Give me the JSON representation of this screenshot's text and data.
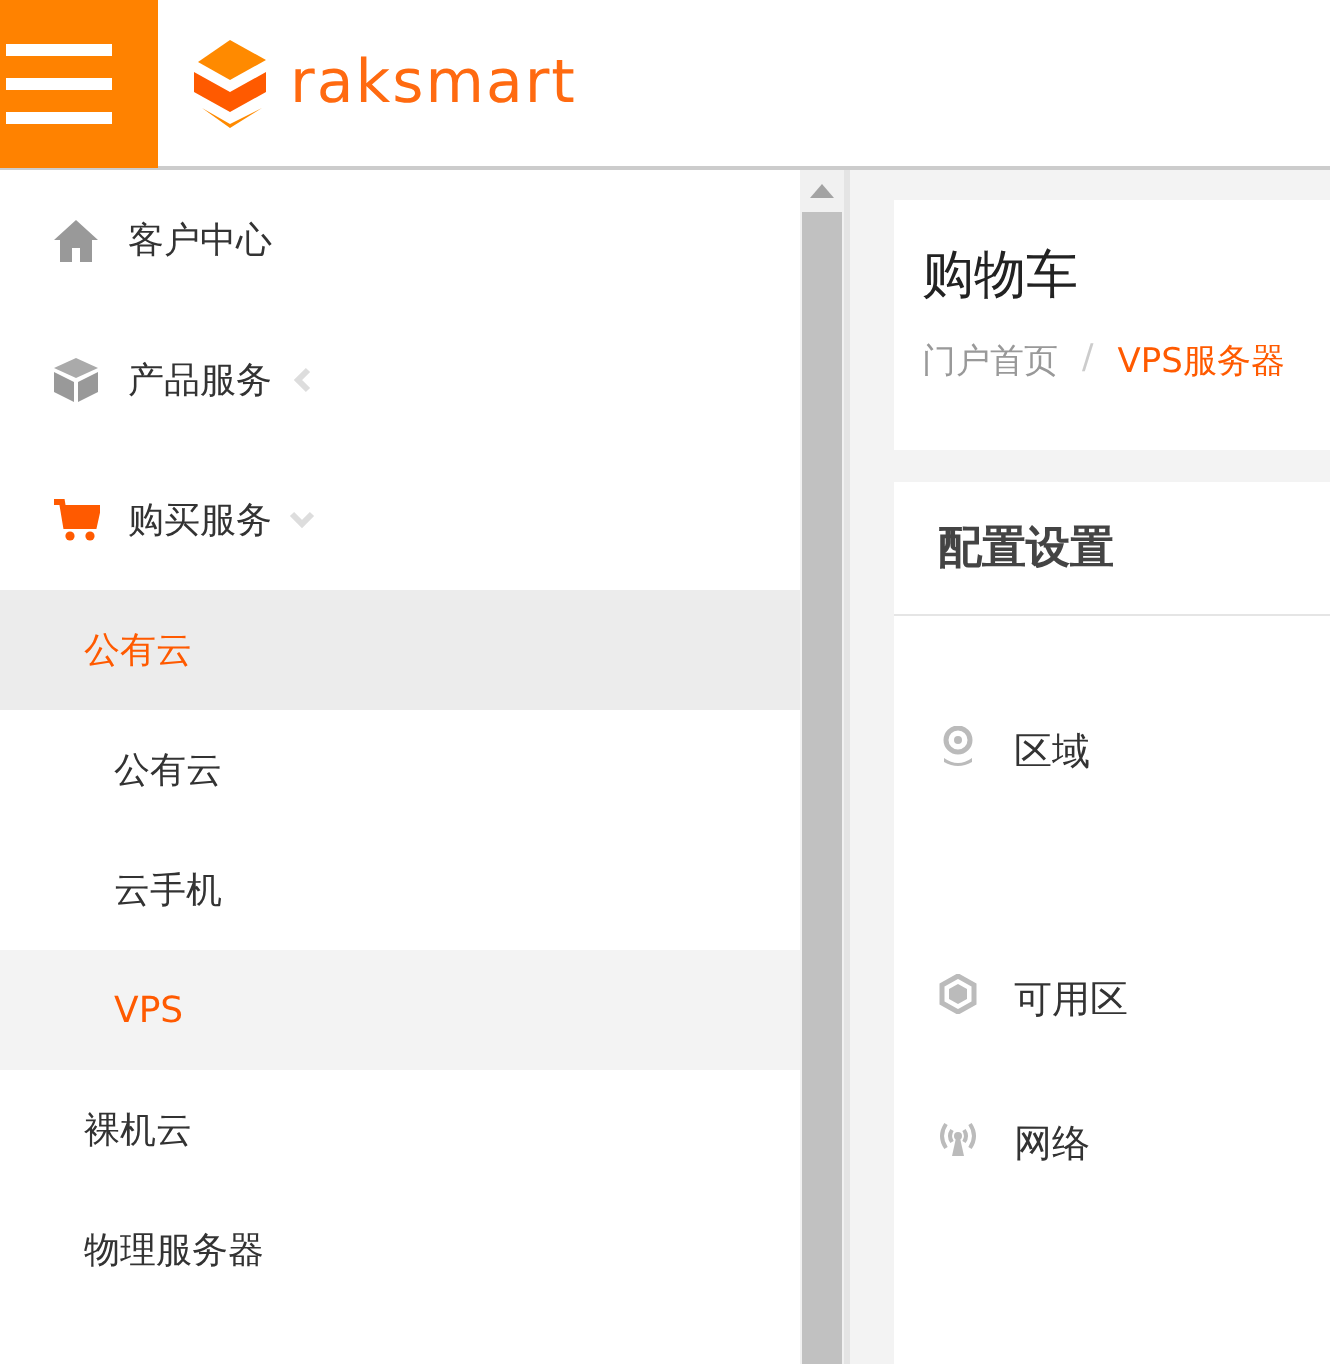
{
  "header": {
    "logo_text": "raksmart"
  },
  "sidebar": {
    "items": [
      {
        "label": "客户中心",
        "kind": "link",
        "selected": false
      },
      {
        "label": "产品服务",
        "kind": "menu",
        "selected": false,
        "expanded": false
      },
      {
        "label": "购买服务",
        "kind": "menu",
        "selected": true,
        "expanded": true,
        "children": [
          {
            "label": "公有云",
            "selected": true,
            "children": [
              {
                "label": "公有云",
                "selected": false
              },
              {
                "label": "云手机",
                "selected": false
              },
              {
                "label": "VPS",
                "selected": true
              }
            ]
          },
          {
            "label": "裸机云",
            "selected": false
          },
          {
            "label": "物理服务器",
            "selected": false
          }
        ]
      }
    ]
  },
  "page": {
    "title": "购物车",
    "separator": "/",
    "breadcrumb": [
      {
        "label": "门户首页",
        "current": false
      },
      {
        "label": "VPS服务器",
        "current": true
      }
    ]
  },
  "config_card": {
    "title": "配置设置",
    "fields": [
      {
        "label": "区域"
      },
      {
        "label": "可用区"
      },
      {
        "label": "网络"
      }
    ]
  }
}
